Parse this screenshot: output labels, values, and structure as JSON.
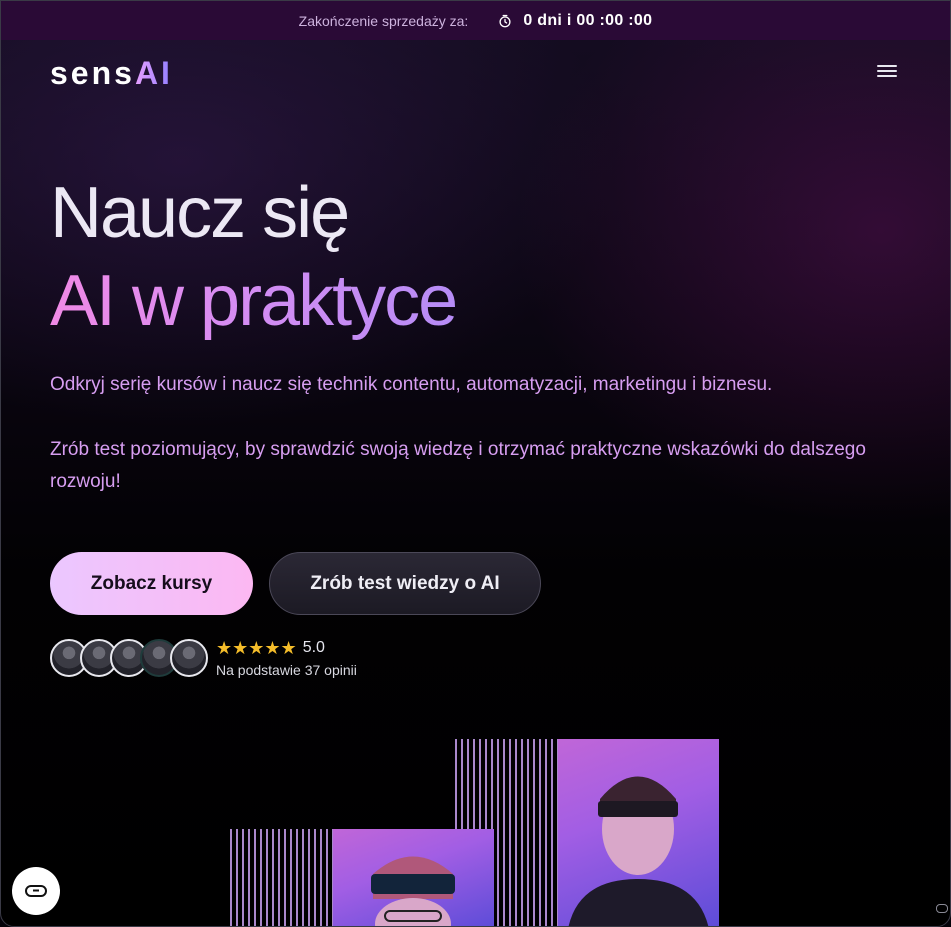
{
  "topbar": {
    "label": "Zakończenie sprzedaży za:",
    "countdown": "0 dni i 00 :00 :00",
    "icon": "clock-icon"
  },
  "header": {
    "logo_main": "sens",
    "logo_ai": "AI",
    "menu_icon": "hamburger-menu-icon"
  },
  "hero": {
    "title_line1": "Naucz się",
    "title_line2": "AI w praktyce",
    "paragraph1": "Odkryj serię kursów i naucz się technik contentu, automatyzacji, marketingu i biznesu.",
    "paragraph2": "Zrób test poziomujący, by sprawdzić swoją wiedzę i otrzymać praktyczne wskazówki do dalszego rozwoju!",
    "cta_primary": "Zobacz kursy",
    "cta_secondary": "Zrób test wiedzy o AI"
  },
  "social_proof": {
    "stars": "★★★★★",
    "rating": "5.0",
    "reviews": "Na podstawie 37 opinii"
  },
  "colors": {
    "accent_pink": "#f08ae6",
    "accent_purple": "#b68cf6",
    "topbar_bg": "#2a0a36",
    "star": "#f5bd2a"
  },
  "chat_widget": {
    "icon": "chat-loop-icon"
  }
}
